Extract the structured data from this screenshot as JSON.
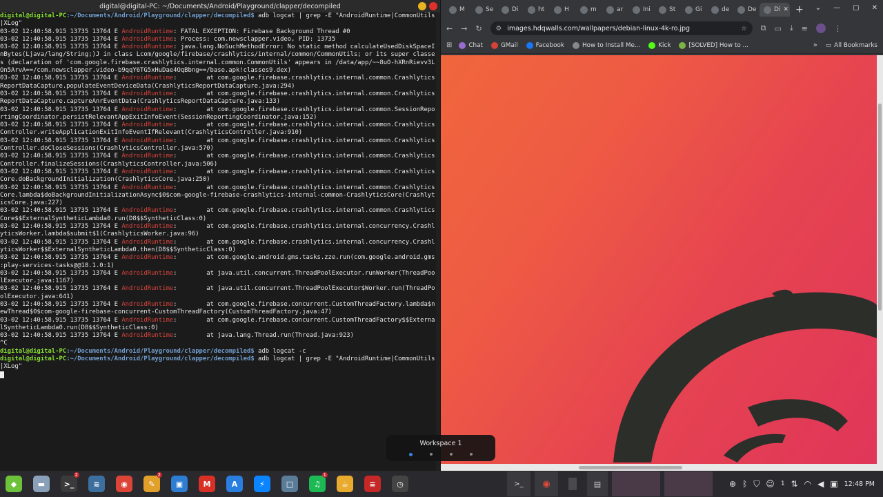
{
  "terminal": {
    "title": "digital@digital-PC: ~/Documents/Android/Playground/clapper/decompiled",
    "prompt_user": "digital@digital-PC",
    "prompt_path": ":~/Documents/Android/Playground/clapper/decompiled$",
    "lines": [
      {
        "pre": "",
        "tag": "",
        "text": "digital@digital-PC:~/Documents/Android/Playground/clapper/decompiled$ adb logcat | grep -E \"AndroidRuntime|CommonUtils"
      },
      {
        "pre": "",
        "tag": "",
        "text": "|XLog\""
      },
      {
        "pre": "03-02 12:40:58.915 13735 13764 E ",
        "tag": "AndroidRuntime",
        "text": ": FATAL EXCEPTION: Firebase Background Thread #0"
      },
      {
        "pre": "03-02 12:40:58.915 13735 13764 E ",
        "tag": "AndroidRuntime",
        "text": ": Process: com.newsclapper.video, PID: 13735"
      },
      {
        "pre": "03-02 12:40:58.915 13735 13764 E ",
        "tag": "AndroidRuntime",
        "text": ": java.lang.NoSuchMethodError: No static method calculateUsedDiskSpaceI"
      },
      {
        "pre": "",
        "tag": "",
        "text": "nBytes(Ljava/lang/String;)J in class Lcom/google/firebase/crashlytics/internal/common/CommonUtils; or its super classe"
      },
      {
        "pre": "",
        "tag": "",
        "text": "s (declaration of 'com.google.firebase.crashlytics.internal.common.CommonUtils' appears in /data/app/~~8uO-hXRnRievv3L"
      },
      {
        "pre": "",
        "tag": "",
        "text": "On5ArvA==/com.newsclapper.video-b9qqY6TG5xHuDae4OqBbng==/base.apk!classes9.dex)"
      },
      {
        "pre": "03-02 12:40:58.915 13735 13764 E ",
        "tag": "AndroidRuntime",
        "text": ":        at com.google.firebase.crashlytics.internal.common.Crashlytics"
      },
      {
        "pre": "",
        "tag": "",
        "text": "ReportDataCapture.populateEventDeviceData(CrashlyticsReportDataCapture.java:294)"
      },
      {
        "pre": "03-02 12:40:58.915 13735 13764 E ",
        "tag": "AndroidRuntime",
        "text": ":        at com.google.firebase.crashlytics.internal.common.Crashlytics"
      },
      {
        "pre": "",
        "tag": "",
        "text": "ReportDataCapture.captureAnrEventData(CrashlyticsReportDataCapture.java:133)"
      },
      {
        "pre": "03-02 12:40:58.915 13735 13764 E ",
        "tag": "AndroidRuntime",
        "text": ":        at com.google.firebase.crashlytics.internal.common.SessionRepo"
      },
      {
        "pre": "",
        "tag": "",
        "text": "rtingCoordinator.persistRelevantAppExitInfoEvent(SessionReportingCoordinator.java:152)"
      },
      {
        "pre": "03-02 12:40:58.915 13735 13764 E ",
        "tag": "AndroidRuntime",
        "text": ":        at com.google.firebase.crashlytics.internal.common.Crashlytics"
      },
      {
        "pre": "",
        "tag": "",
        "text": "Controller.writeApplicationExitInfoEventIfRelevant(CrashlyticsController.java:910)"
      },
      {
        "pre": "03-02 12:40:58.915 13735 13764 E ",
        "tag": "AndroidRuntime",
        "text": ":        at com.google.firebase.crashlytics.internal.common.Crashlytics"
      },
      {
        "pre": "",
        "tag": "",
        "text": "Controller.doCloseSessions(CrashlyticsController.java:570)"
      },
      {
        "pre": "03-02 12:40:58.915 13735 13764 E ",
        "tag": "AndroidRuntime",
        "text": ":        at com.google.firebase.crashlytics.internal.common.Crashlytics"
      },
      {
        "pre": "",
        "tag": "",
        "text": "Controller.finalizeSessions(CrashlyticsController.java:506)"
      },
      {
        "pre": "03-02 12:40:58.915 13735 13764 E ",
        "tag": "AndroidRuntime",
        "text": ":        at com.google.firebase.crashlytics.internal.common.Crashlytics"
      },
      {
        "pre": "",
        "tag": "",
        "text": "Core.doBackgroundInitialization(CrashlyticsCore.java:250)"
      },
      {
        "pre": "03-02 12:40:58.915 13735 13764 E ",
        "tag": "AndroidRuntime",
        "text": ":        at com.google.firebase.crashlytics.internal.common.Crashlytics"
      },
      {
        "pre": "",
        "tag": "",
        "text": "Core.lambda$doBackgroundInitializationAsync$0$com-google-firebase-crashlytics-internal-common-CrashlyticsCore(Crashlyt"
      },
      {
        "pre": "",
        "tag": "",
        "text": "icsCore.java:227)"
      },
      {
        "pre": "03-02 12:40:58.915 13735 13764 E ",
        "tag": "AndroidRuntime",
        "text": ":        at com.google.firebase.crashlytics.internal.common.Crashlytics"
      },
      {
        "pre": "",
        "tag": "",
        "text": "Core$$ExternalSyntheticLambda0.run(D8$$SyntheticClass:0)"
      },
      {
        "pre": "03-02 12:40:58.915 13735 13764 E ",
        "tag": "AndroidRuntime",
        "text": ":        at com.google.firebase.crashlytics.internal.concurrency.Crashl"
      },
      {
        "pre": "",
        "tag": "",
        "text": "yticsWorker.lambda$submit$1(CrashlyticsWorker.java:96)"
      },
      {
        "pre": "03-02 12:40:58.915 13735 13764 E ",
        "tag": "AndroidRuntime",
        "text": ":        at com.google.firebase.crashlytics.internal.concurrency.Crashl"
      },
      {
        "pre": "",
        "tag": "",
        "text": "yticsWorker$$ExternalSyntheticLambda0.then(D8$$SyntheticClass:0)"
      },
      {
        "pre": "03-02 12:40:58.915 13735 13764 E ",
        "tag": "AndroidRuntime",
        "text": ":        at com.google.android.gms.tasks.zze.run(com.google.android.gms"
      },
      {
        "pre": "",
        "tag": "",
        "text": ":play-services-tasks@@18.1.0:1)"
      },
      {
        "pre": "03-02 12:40:58.915 13735 13764 E ",
        "tag": "AndroidRuntime",
        "text": ":        at java.util.concurrent.ThreadPoolExecutor.runWorker(ThreadPoo"
      },
      {
        "pre": "",
        "tag": "",
        "text": "lExecutor.java:1167)"
      },
      {
        "pre": "03-02 12:40:58.915 13735 13764 E ",
        "tag": "AndroidRuntime",
        "text": ":        at java.util.concurrent.ThreadPoolExecutor$Worker.run(ThreadPo"
      },
      {
        "pre": "",
        "tag": "",
        "text": "olExecutor.java:641)"
      },
      {
        "pre": "03-02 12:40:58.915 13735 13764 E ",
        "tag": "AndroidRuntime",
        "text": ":        at com.google.firebase.concurrent.CustomThreadFactory.lambda$n"
      },
      {
        "pre": "",
        "tag": "",
        "text": "ewThread$0$com-google-firebase-concurrent-CustomThreadFactory(CustomThreadFactory.java:47)"
      },
      {
        "pre": "03-02 12:40:58.915 13735 13764 E ",
        "tag": "AndroidRuntime",
        "text": ":        at com.google.firebase.concurrent.CustomThreadFactory$$Externa"
      },
      {
        "pre": "",
        "tag": "",
        "text": "lSyntheticLambda0.run(D8$$SyntheticClass:0)"
      },
      {
        "pre": "03-02 12:40:58.915 13735 13764 E ",
        "tag": "AndroidRuntime",
        "text": ":        at java.lang.Thread.run(Thread.java:923)"
      },
      {
        "pre": "",
        "tag": "",
        "text": "^C"
      },
      {
        "pre": "",
        "tag": "",
        "text": "digital@digital-PC:~/Documents/Android/Playground/clapper/decompiled$ adb logcat -c"
      },
      {
        "pre": "",
        "tag": "",
        "text": "digital@digital-PC:~/Documents/Android/Playground/clapper/decompiled$ adb logcat | grep -E \"AndroidRuntime|CommonUtils"
      },
      {
        "pre": "",
        "tag": "",
        "text": "|XLog\""
      }
    ]
  },
  "browser": {
    "tabs": [
      {
        "label": "M",
        "icon": "medium-icon"
      },
      {
        "label": "Se",
        "icon": "xda-icon"
      },
      {
        "label": "Di",
        "icon": "debian-icon"
      },
      {
        "label": "ht",
        "icon": "github-icon"
      },
      {
        "label": "H",
        "icon": "xda-icon"
      },
      {
        "label": "m",
        "icon": "edit-icon"
      },
      {
        "label": "ar",
        "icon": "stackoverflow-icon"
      },
      {
        "label": "Ini",
        "icon": "xda-icon"
      },
      {
        "label": "St",
        "icon": "github-icon"
      },
      {
        "label": "Gi",
        "icon": "gemini-icon"
      },
      {
        "label": "de",
        "icon": "chrome-icon"
      },
      {
        "label": "De",
        "icon": "page-icon"
      },
      {
        "label": "Di",
        "icon": "globe-icon"
      }
    ],
    "url": "images.hdqwalls.com/wallpapers/debian-linux-4k-ro.jpg",
    "bookmarks": [
      {
        "label": "Chat",
        "color": "#9a6bd1"
      },
      {
        "label": "GMail",
        "color": "#d64237"
      },
      {
        "label": "Facebook",
        "color": "#1877f2"
      },
      {
        "label": "How to Install Me...",
        "color": "#888888"
      },
      {
        "label": "Kick",
        "color": "#53fc18"
      },
      {
        "label": "[SOLVED] How to ...",
        "color": "#7cb342"
      }
    ],
    "all_bookmarks": "All Bookmarks"
  },
  "workspace": {
    "label": "Workspace 1",
    "count": 4,
    "active_index": 0
  },
  "taskbar": {
    "apps": [
      {
        "name": "app-launcher-icon",
        "color": "#6ec13a",
        "glyph": "◆"
      },
      {
        "name": "files-icon",
        "color": "#8aa0b8",
        "glyph": "▬"
      },
      {
        "name": "terminal-icon",
        "color": "#3a3a3a",
        "glyph": ">_"
      },
      {
        "name": "system-monitor-icon",
        "color": "#3d6f9e",
        "glyph": "≋"
      },
      {
        "name": "chrome-icon",
        "color": "#db4437",
        "glyph": "◉"
      },
      {
        "name": "text-editor-icon",
        "color": "#e0a02a",
        "glyph": "✎"
      },
      {
        "name": "vscode-icon",
        "color": "#2d7dd2",
        "glyph": "▣"
      },
      {
        "name": "gmail-icon",
        "color": "#d93025",
        "glyph": "M"
      },
      {
        "name": "android-studio-icon",
        "color": "#2a7ee0",
        "glyph": "A"
      },
      {
        "name": "messenger-icon",
        "color": "#0a84ff",
        "glyph": "⚡"
      },
      {
        "name": "virtualbox-icon",
        "color": "#5b7c99",
        "glyph": "□"
      },
      {
        "name": "spotify-icon",
        "color": "#1db954",
        "glyph": "♫"
      },
      {
        "name": "java-icon",
        "color": "#e8ab2e",
        "glyph": "☕"
      },
      {
        "name": "pdf-viewer-icon",
        "color": "#c62828",
        "glyph": "≡"
      },
      {
        "name": "clock-app-icon",
        "color": "#444444",
        "glyph": "◷"
      }
    ],
    "badges": {
      "terminal": "2",
      "text-editor": "2",
      "spotify": "1"
    },
    "clock": "12:48 PM",
    "battery_label": "1"
  },
  "colors": {
    "terminal_bg": "#1b1b1b",
    "log_tag": "#d8453e",
    "prompt_user": "#8ae234",
    "prompt_path": "#729fcf",
    "wallpaper_start": "#f0663c",
    "wallpaper_end": "#e0355a",
    "taskbar_bg": "#2a2a2e",
    "workspace_active_dot": "#3584e4"
  }
}
